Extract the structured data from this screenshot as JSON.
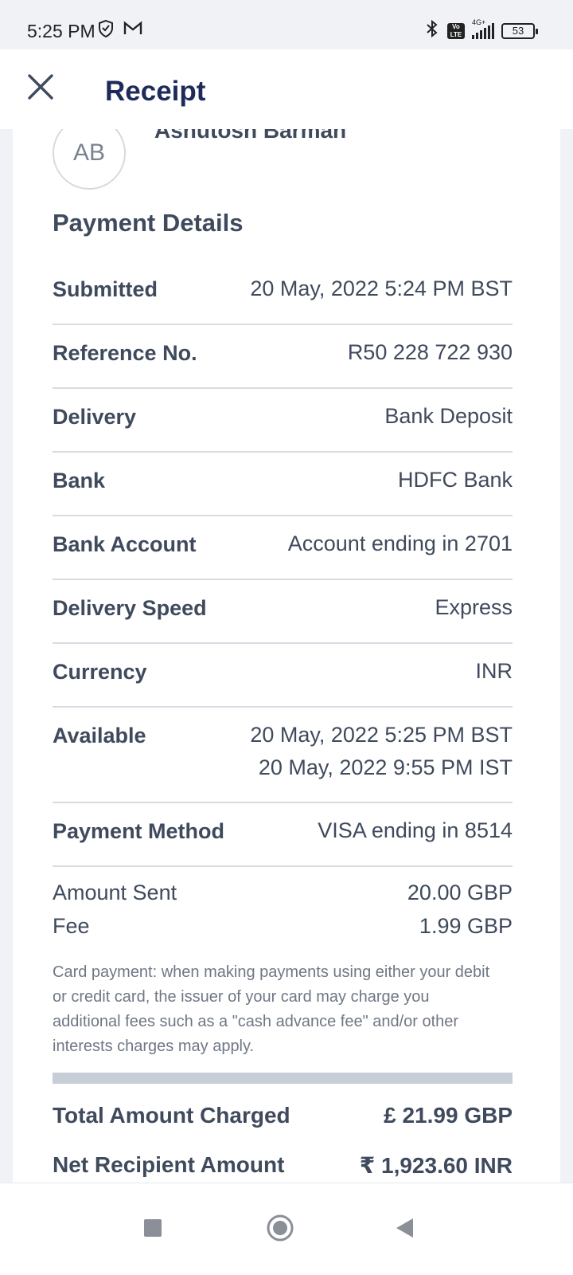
{
  "status_bar": {
    "time": "5:25 PM",
    "battery": "53",
    "network": "4G+",
    "volte": "Vo LTE"
  },
  "header": {
    "title": "Receipt",
    "close_icon": "close-icon"
  },
  "recipient": {
    "initials": "AB",
    "name": "Ashutosh Barman"
  },
  "payment_details": {
    "title": "Payment Details",
    "rows": [
      {
        "label": "Submitted",
        "value": "20 May, 2022 5:24 PM BST"
      },
      {
        "label": "Reference No.",
        "value": "R50 228 722 930"
      },
      {
        "label": "Delivery",
        "value": "Bank Deposit"
      },
      {
        "label": "Bank",
        "value": "HDFC Bank"
      },
      {
        "label": "Bank Account",
        "value": "Account ending in 2701"
      },
      {
        "label": "Delivery Speed",
        "value": "Express"
      },
      {
        "label": "Currency",
        "value": "INR"
      },
      {
        "label": "Available",
        "value": "20 May, 2022 5:25 PM BST",
        "value2": "20 May, 2022 9:55 PM IST"
      },
      {
        "label": "Payment Method",
        "value": "VISA ending in 8514"
      }
    ]
  },
  "amounts": {
    "sent_label": "Amount Sent",
    "sent_value": "20.00 GBP",
    "fee_label": "Fee",
    "fee_value": "1.99 GBP"
  },
  "disclaimer": "Card payment: when making payments using either your debit or credit card, the issuer of your card may charge you additional fees such as a \"cash advance fee\" and/or other interests charges may apply.",
  "totals": {
    "charged_label": "Total Amount Charged",
    "charged_value": "£ 21.99 GBP",
    "net_label": "Net Recipient Amount",
    "net_value": "₹ 1,923.60 INR"
  },
  "colors": {
    "title": "#1e2a5a",
    "text": "#3f4a5c",
    "divider": "#d8dce2",
    "bar": "#c7ced8"
  }
}
